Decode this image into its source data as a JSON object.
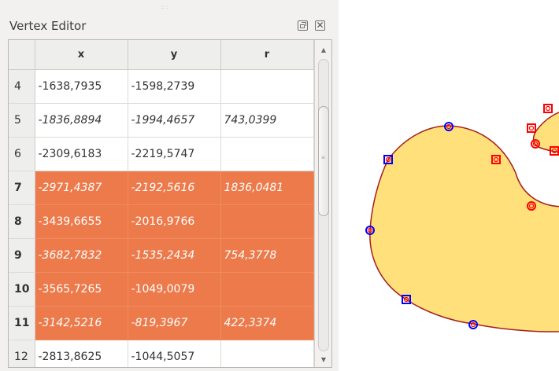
{
  "panel": {
    "title": "Vertex Editor",
    "columns": [
      "",
      "x",
      "y",
      "r"
    ],
    "rows": [
      {
        "num": "4",
        "x": "-1638,7935",
        "y": "-1598,2739",
        "r": "",
        "selected": false,
        "italic": false
      },
      {
        "num": "5",
        "x": "-1836,8894",
        "y": "-1994,4657",
        "r": "743,0399",
        "selected": false,
        "italic": true
      },
      {
        "num": "6",
        "x": "-2309,6183",
        "y": "-2219,5747",
        "r": "",
        "selected": false,
        "italic": false
      },
      {
        "num": "7",
        "x": "-2971,4387",
        "y": "-2192,5616",
        "r": "1836,0481",
        "selected": true,
        "italic": true
      },
      {
        "num": "8",
        "x": "-3439,6655",
        "y": "-2016,9766",
        "r": "",
        "selected": true,
        "italic": false
      },
      {
        "num": "9",
        "x": "-3682,7832",
        "y": "-1535,2434",
        "r": "754,3778",
        "selected": true,
        "italic": true
      },
      {
        "num": "10",
        "x": "-3565,7265",
        "y": "-1049,0079",
        "r": "",
        "selected": true,
        "italic": false
      },
      {
        "num": "11",
        "x": "-3142,5216",
        "y": "-819,3967",
        "r": "422,3374",
        "selected": true,
        "italic": true
      },
      {
        "num": "12",
        "x": "-2813,8625",
        "y": "-1044,5057",
        "r": "",
        "selected": false,
        "italic": false
      }
    ]
  },
  "colors": {
    "selection": "#ec7a4b",
    "polygon_fill": "#ffe07a",
    "polygon_stroke": "#a3201c",
    "vertex_marker": "#ff0000",
    "selected_vertex": "#0000ff"
  },
  "icons": {
    "float": "float-window-icon",
    "close": "close-icon",
    "scroll_up": "arrow-up-icon",
    "scroll_down": "arrow-down-icon"
  }
}
